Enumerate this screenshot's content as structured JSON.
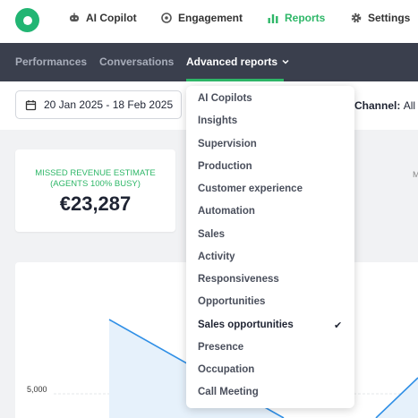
{
  "top_nav": {
    "items": [
      {
        "label": "AI Copilot",
        "icon": "robot-icon",
        "active": false
      },
      {
        "label": "Engagement",
        "icon": "target-icon",
        "active": false
      },
      {
        "label": "Reports",
        "icon": "bar-chart-icon",
        "active": true
      },
      {
        "label": "Settings",
        "icon": "gear-icon",
        "active": false
      }
    ]
  },
  "sub_nav": {
    "items": [
      {
        "label": "Performances"
      },
      {
        "label": "Conversations"
      },
      {
        "label": "Advanced reports",
        "icon": "chevron-down-icon"
      }
    ]
  },
  "filters": {
    "date_range": "20 Jan 2025 - 18 Feb 2025",
    "channel_label": "Channel:",
    "channel_value": "All"
  },
  "metric": {
    "label": "MISSED REVENUE ESTIMATE (AGENTS 100% BUSY)",
    "value": "€23,287"
  },
  "partial_text": "M",
  "chart": {
    "y_tick": "5,000"
  },
  "dropdown": {
    "items": [
      {
        "label": "AI Copilots"
      },
      {
        "label": "Insights"
      },
      {
        "label": "Supervision"
      },
      {
        "label": "Production"
      },
      {
        "label": "Customer experience"
      },
      {
        "label": "Automation"
      },
      {
        "label": "Sales"
      },
      {
        "label": "Activity"
      },
      {
        "label": "Responsiveness"
      },
      {
        "label": "Opportunities"
      },
      {
        "label": "Sales opportunities",
        "selected": true
      },
      {
        "label": "Presence"
      },
      {
        "label": "Occupation"
      },
      {
        "label": "Call Meeting"
      }
    ],
    "check_glyph": "✔"
  },
  "colors": {
    "accent": "#2eb768",
    "subnav_bg": "#3a3f4d",
    "chart_line": "#2f8fe6"
  }
}
